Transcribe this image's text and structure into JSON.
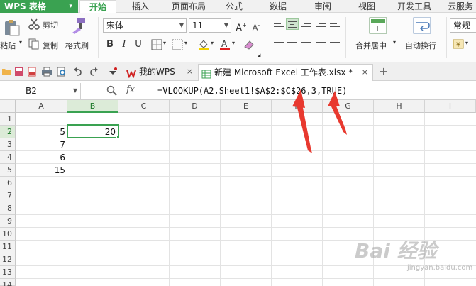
{
  "app": {
    "name": "WPS 表格",
    "caret": "▾"
  },
  "menu": {
    "tabs": [
      {
        "label": "开始",
        "active": true
      },
      {
        "label": "插入"
      },
      {
        "label": "页面布局"
      },
      {
        "label": "公式"
      },
      {
        "label": "数据"
      },
      {
        "label": "审阅"
      },
      {
        "label": "视图"
      },
      {
        "label": "开发工具"
      },
      {
        "label": "云服务"
      }
    ]
  },
  "ribbon": {
    "paste": "粘贴",
    "cut": "剪切",
    "copy": "复制",
    "format_painter": "格式刷",
    "font_name": "宋体",
    "font_size": "11",
    "merge_center": "合并居中",
    "wrap_text": "自动换行",
    "number_format": "常规"
  },
  "docbar": {
    "tabs": [
      {
        "label": "我的WPS",
        "close": "×"
      },
      {
        "label": "新建 Microsoft Excel 工作表.xlsx *",
        "close": "×",
        "active": true
      }
    ],
    "new_tab": "+"
  },
  "formula_bar": {
    "name_box": "B2",
    "fx": "fx",
    "formula": "=VLOOKUP(A2,Sheet1!$A$2:$C$26,3,TRUE)"
  },
  "sheet": {
    "columns": [
      "A",
      "B",
      "C",
      "D",
      "E",
      "F",
      "G",
      "H",
      "I"
    ],
    "rows": [
      "1",
      "2",
      "3",
      "4",
      "5",
      "6",
      "7",
      "8",
      "9",
      "10",
      "11",
      "12",
      "13",
      "14"
    ],
    "selected_cell": "B2",
    "cells": {
      "A2": "5",
      "B2": "20",
      "A3": "7",
      "A4": "6",
      "A5": "15"
    }
  },
  "watermark": {
    "text": "Bai 经验",
    "sub": "jingyan.baidu.com"
  },
  "colors": {
    "accent": "#3aa251",
    "arrow": "#e8392f"
  }
}
